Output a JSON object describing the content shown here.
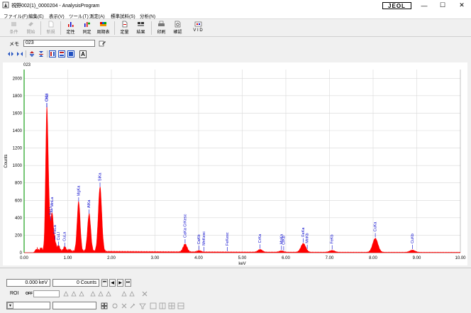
{
  "window": {
    "title": "視野002(1)_0000204 - AnalysisProgram",
    "brand": "JEOL",
    "minimize": "—",
    "maximize": "☐",
    "close": "✕"
  },
  "menu": [
    "ファイル(F)",
    "編集(E)",
    "表示(V)",
    "ツール(T)",
    "測定(A)",
    "標準試料(S)",
    "分析(N)"
  ],
  "toolbar": {
    "items": [
      {
        "label": "条件",
        "icon": "conditions-icon",
        "enabled": false
      },
      {
        "label": "開始",
        "icon": "start-icon",
        "enabled": false
      },
      {
        "label": "新規",
        "icon": "new-icon",
        "enabled": false
      },
      {
        "label": "定性",
        "icon": "qualitative-icon",
        "enabled": true
      },
      {
        "label": "同定",
        "icon": "identify-icon",
        "enabled": true
      },
      {
        "label": "周期表",
        "icon": "periodic-table-icon",
        "enabled": true
      },
      {
        "label": "定量",
        "icon": "quantitative-icon",
        "enabled": true
      },
      {
        "label": "結果",
        "icon": "result-icon",
        "enabled": true
      },
      {
        "label": "印刷",
        "icon": "print-icon",
        "enabled": true
      },
      {
        "label": "確認",
        "icon": "confirm-icon",
        "enabled": true
      },
      {
        "label": "V I D",
        "icon": "vid-icon",
        "enabled": true
      }
    ]
  },
  "memo": {
    "label": "メモ",
    "value": "023"
  },
  "format_toolbar": {
    "text_button": "A"
  },
  "status": {
    "energy": "0.000 keV",
    "counts": "0 Counts",
    "nav": [
      "⏮",
      "◀",
      "▶",
      "⏭"
    ]
  },
  "roi": {
    "label": "ROI",
    "toggle": "OFF"
  },
  "chart_data": {
    "type": "line",
    "title": "023",
    "xlabel": "keV",
    "ylabel": "Counts",
    "xlim": [
      0,
      10
    ],
    "ylim": [
      0,
      2100
    ],
    "x_ticks": [
      "0.00",
      "1.00",
      "2.00",
      "3.00",
      "4.00",
      "5.00",
      "6.00",
      "7.00",
      "8.00",
      "9.00",
      "10.00"
    ],
    "y_ticks": [
      "0",
      "200",
      "400",
      "600",
      "800",
      "1000",
      "1200",
      "1400",
      "1600",
      "1800",
      "2000"
    ],
    "grid": true,
    "fill_color": "#ff0000",
    "label_color": "#0000cc",
    "peaks": [
      {
        "x": 0.28,
        "y": 40,
        "w": 0.03
      },
      {
        "x": 0.39,
        "y": 35,
        "w": 0.025
      },
      {
        "x": 0.52,
        "y": 1600,
        "w": 0.028
      },
      {
        "x": 0.57,
        "y": 380,
        "w": 0.025
      },
      {
        "x": 0.64,
        "y": 420,
        "w": 0.028
      },
      {
        "x": 0.7,
        "y": 120,
        "w": 0.03
      },
      {
        "x": 0.79,
        "y": 60,
        "w": 0.03
      },
      {
        "x": 0.93,
        "y": 50,
        "w": 0.03
      },
      {
        "x": 1.04,
        "y": 20,
        "w": 0.03
      },
      {
        "x": 1.25,
        "y": 570,
        "w": 0.035
      },
      {
        "x": 1.49,
        "y": 430,
        "w": 0.037
      },
      {
        "x": 1.74,
        "y": 740,
        "w": 0.04
      },
      {
        "x": 3.69,
        "y": 90,
        "w": 0.045
      },
      {
        "x": 4.01,
        "y": 15,
        "w": 0.045
      },
      {
        "x": 5.41,
        "y": 30,
        "w": 0.05
      },
      {
        "x": 5.9,
        "y": 15,
        "w": 0.05
      },
      {
        "x": 6.4,
        "y": 100,
        "w": 0.055
      },
      {
        "x": 7.06,
        "y": 20,
        "w": 0.06
      },
      {
        "x": 8.05,
        "y": 160,
        "w": 0.06
      },
      {
        "x": 8.9,
        "y": 25,
        "w": 0.06
      }
    ],
    "labels": [
      {
        "text": "OKa",
        "x": 0.52
      },
      {
        "text": "CuLl",
        "x": 0.52
      },
      {
        "text": "FeLl",
        "x": 0.61
      },
      {
        "text": "MnLa",
        "x": 0.64
      },
      {
        "text": "FeLa",
        "x": 0.71
      },
      {
        "text": "CuLl",
        "x": 0.79
      },
      {
        "text": "CuLa",
        "x": 0.93
      },
      {
        "text": "MgKa",
        "x": 1.25
      },
      {
        "text": "AlKa",
        "x": 1.49
      },
      {
        "text": "SiKa",
        "x": 1.74
      },
      {
        "text": "CaKa CrKesc",
        "x": 3.69
      },
      {
        "text": "CaKb",
        "x": 4.01
      },
      {
        "text": "MnKesc",
        "x": 4.12
      },
      {
        "text": "FeKesc",
        "x": 4.66
      },
      {
        "text": "CrKa",
        "x": 5.41
      },
      {
        "text": "CrKb",
        "x": 5.95
      },
      {
        "text": "MnKa",
        "x": 5.9
      },
      {
        "text": "FeKa",
        "x": 6.4
      },
      {
        "text": "MnKb",
        "x": 6.49
      },
      {
        "text": "FeKb",
        "x": 7.06
      },
      {
        "text": "CuKa",
        "x": 8.05
      },
      {
        "text": "CuKb",
        "x": 8.9
      }
    ]
  }
}
